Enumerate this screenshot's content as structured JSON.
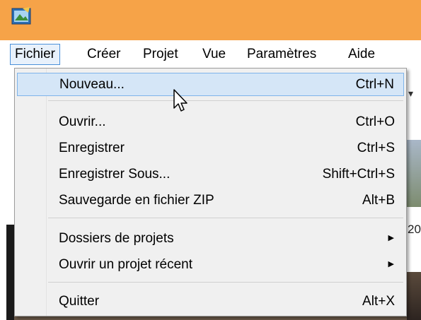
{
  "menubar": {
    "items": [
      {
        "label": "Fichier"
      },
      {
        "label": "Créer"
      },
      {
        "label": "Projet"
      },
      {
        "label": "Vue"
      },
      {
        "label": "Paramètres"
      },
      {
        "label": "Aide"
      }
    ]
  },
  "file_menu": {
    "items": [
      {
        "label": "Nouveau...",
        "shortcut": "Ctrl+N"
      },
      {
        "label": "Ouvrir...",
        "shortcut": "Ctrl+O"
      },
      {
        "label": "Enregistrer",
        "shortcut": "Ctrl+S"
      },
      {
        "label": "Enregistrer Sous...",
        "shortcut": "Shift+Ctrl+S"
      },
      {
        "label": "Sauvegarde en fichier ZIP",
        "shortcut": "Alt+B"
      },
      {
        "label": "Dossiers de projets"
      },
      {
        "label": "Ouvrir un projet récent"
      },
      {
        "label": "Quitter",
        "shortcut": "Alt+X"
      }
    ]
  },
  "background": {
    "partial_text": "20"
  },
  "colors": {
    "titlebar": "#f6a348",
    "hover": "#d5e6f7",
    "hover_border": "#7eb4ea",
    "menu_bg": "#f0f0f0"
  }
}
